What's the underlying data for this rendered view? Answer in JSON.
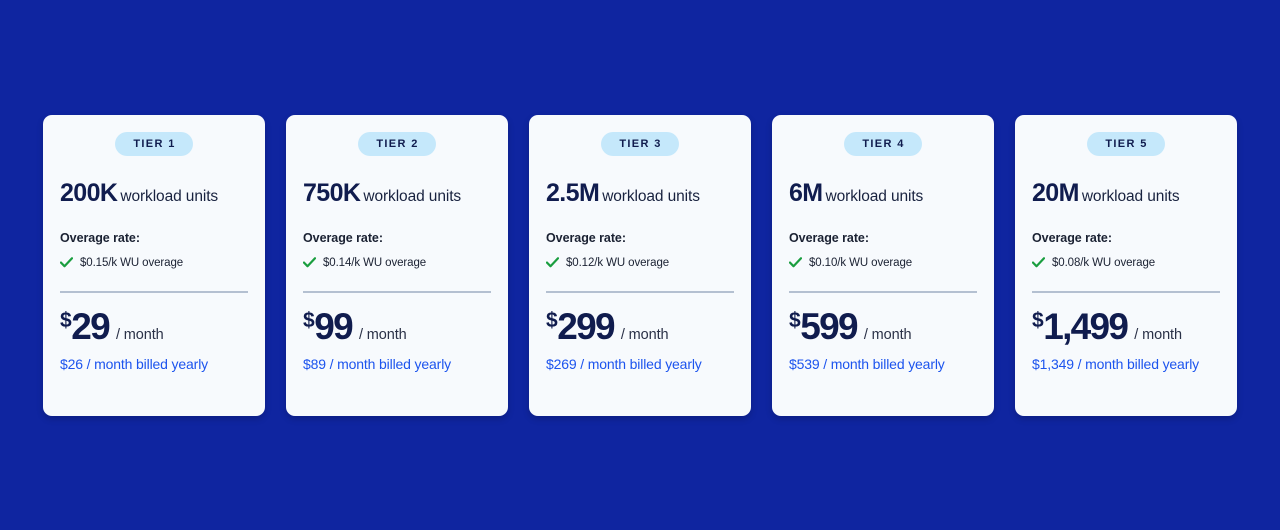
{
  "theme": {
    "page_background": "#0f25a0",
    "card_background": "#f7fafd",
    "badge_background": "#c5e8fb",
    "badge_text": "#101c4e",
    "heading_navy": "#101c4e",
    "check_green": "#1a9e3f",
    "link_blue": "#1c54ee",
    "divider": "#b4c0d1"
  },
  "cards": [
    {
      "badge": "TIER 1",
      "units_amount": "200K",
      "units_label": "workload units",
      "overage_title": "Overage rate:",
      "overage_text": "$0.15/k WU overage",
      "price_currency": "$",
      "price_amount": "29",
      "price_period": "/ month",
      "yearly_note": "$26 / month billed yearly"
    },
    {
      "badge": "TIER 2",
      "units_amount": "750K",
      "units_label": "workload units",
      "overage_title": "Overage rate:",
      "overage_text": "$0.14/k WU overage",
      "price_currency": "$",
      "price_amount": "99",
      "price_period": "/ month",
      "yearly_note": "$89 / month billed yearly"
    },
    {
      "badge": "TIER 3",
      "units_amount": "2.5M",
      "units_label": "workload units",
      "overage_title": "Overage rate:",
      "overage_text": "$0.12/k WU overage",
      "price_currency": "$",
      "price_amount": "299",
      "price_period": "/ month",
      "yearly_note": "$269 / month billed yearly"
    },
    {
      "badge": "TIER 4",
      "units_amount": "6M",
      "units_label": "workload units",
      "overage_title": "Overage rate:",
      "overage_text": "$0.10/k WU overage",
      "price_currency": "$",
      "price_amount": "599",
      "price_period": "/ month",
      "yearly_note": "$539 / month billed yearly"
    },
    {
      "badge": "TIER 5",
      "units_amount": "20M",
      "units_label": "workload units",
      "overage_title": "Overage rate:",
      "overage_text": "$0.08/k WU overage",
      "price_currency": "$",
      "price_amount": "1,499",
      "price_period": "/ month",
      "yearly_note": "$1,349 / month billed yearly"
    }
  ]
}
